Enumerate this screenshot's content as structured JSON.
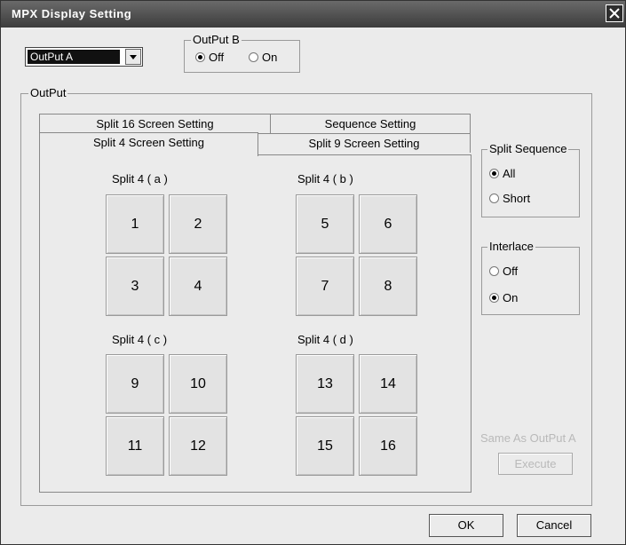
{
  "window": {
    "title": "MPX Display Setting"
  },
  "output_select": {
    "value": "OutPut A"
  },
  "output_b": {
    "label": "OutPut B",
    "off": "Off",
    "on": "On",
    "selected": "Off"
  },
  "output_group": {
    "label": "OutPut"
  },
  "tabs": [
    {
      "label": "Split 16 Screen Setting"
    },
    {
      "label": "Sequence Setting"
    },
    {
      "label": "Split 4 Screen Setting",
      "selected": true
    },
    {
      "label": "Split 9 Screen Setting"
    }
  ],
  "split_groups": [
    {
      "label": "Split 4 ( a )",
      "cells": [
        "1",
        "2",
        "3",
        "4"
      ]
    },
    {
      "label": "Split 4 ( b )",
      "cells": [
        "5",
        "6",
        "7",
        "8"
      ]
    },
    {
      "label": "Split 4 ( c )",
      "cells": [
        "9",
        "10",
        "11",
        "12"
      ]
    },
    {
      "label": "Split 4 ( d )",
      "cells": [
        "13",
        "14",
        "15",
        "16"
      ]
    }
  ],
  "split_sequence": {
    "label": "Split Sequence",
    "options": [
      "All",
      "Short"
    ],
    "selected": "All"
  },
  "interlace": {
    "label": "Interlace",
    "options": [
      "Off",
      "On"
    ],
    "selected": "On"
  },
  "same_as": {
    "label": "Same As OutPut A",
    "button": "Execute"
  },
  "footer": {
    "ok": "OK",
    "cancel": "Cancel"
  }
}
